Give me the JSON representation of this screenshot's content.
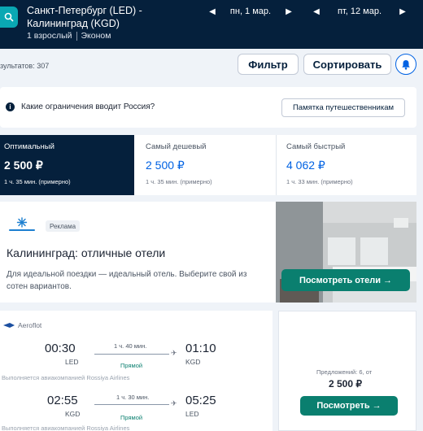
{
  "header": {
    "route": "Санкт-Петербург (LED) - Калининград (KGD)",
    "passengers": "1 взрослый",
    "cabin": "Эконом",
    "depart_date": "пн, 1 мар.",
    "return_date": "пт, 12 мар."
  },
  "toolbar": {
    "results_count": "зультатов: 307",
    "filter_label": "Фильтр",
    "sort_label": "Сортировать"
  },
  "info_banner": {
    "text": "Какие ограничения вводит Россия?",
    "button_label": "Памятка путешественникам"
  },
  "sort_tabs": [
    {
      "name": "Оптимальный",
      "price": "2 500 ₽",
      "duration": "1 ч. 35 мин. (примерно)",
      "active": true
    },
    {
      "name": "Самый дешевый",
      "price": "2 500 ₽",
      "duration": "1 ч. 35 мин. (примерно)",
      "active": false
    },
    {
      "name": "Самый быстрый",
      "price": "4 062 ₽",
      "duration": "1 ч. 33 мин. (примерно)",
      "active": false
    }
  ],
  "ad": {
    "badge": "Реклама",
    "title": "Калининград: отличные отели",
    "description": "Для идеальной поездки — идеальный отель. Выберите свой из сотен вариантов.",
    "cta": "Посмотреть отели →"
  },
  "flight": {
    "airline": "Aeroflot",
    "outbound": {
      "depart_time": "00:30",
      "depart_code": "LED",
      "duration": "1 ч. 40 мин.",
      "stops": "Прямой",
      "arrive_time": "01:10",
      "arrive_code": "KGD"
    },
    "operated_by": "Выполняется авиакомпанией Rossiya Airlines",
    "return": {
      "depart_time": "02:55",
      "depart_code": "KGD",
      "duration": "1 ч. 30 мин.",
      "stops": "Прямой",
      "arrive_time": "05:25",
      "arrive_code": "LED"
    },
    "operated_by_2": "Выполняется авиакомпанией Rossiya Airlines",
    "offers": "Предложений: 6, от",
    "price": "2 500 ₽",
    "select_label": "Посмотреть →"
  },
  "colors": {
    "header_bg": "#05203c",
    "accent_blue": "#0062e3",
    "cta_green": "#0a7f6f",
    "search_teal": "#0aa8b3"
  },
  "icons": [
    "search-icon",
    "chevron-left-icon",
    "chevron-right-icon",
    "bell-icon",
    "info-icon",
    "airplane-icon",
    "aeroflot-logo-icon"
  ]
}
